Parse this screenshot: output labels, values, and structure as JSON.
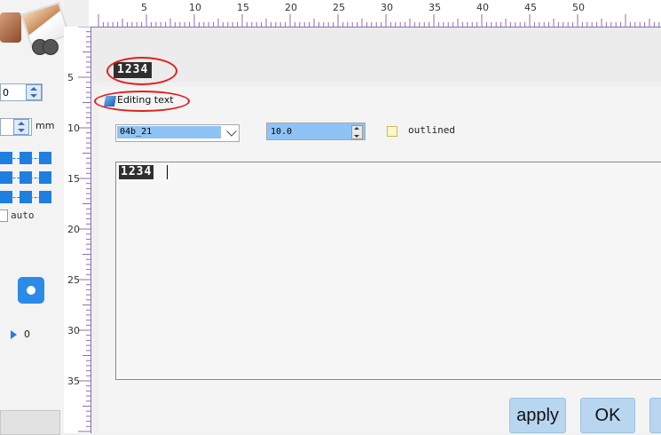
{
  "left_panel": {
    "spin_top_value": "0",
    "unit_label": "mm",
    "auto_label": "auto",
    "play_value": "0"
  },
  "ruler": {
    "h_labels": [
      "5",
      "10",
      "15",
      "20",
      "25",
      "30",
      "35",
      "40",
      "45",
      "50"
    ],
    "v_labels": [
      "5",
      "10",
      "15",
      "20",
      "25",
      "30",
      "35"
    ]
  },
  "preview": {
    "text": "1234"
  },
  "dialog": {
    "title": "Editing text",
    "font_value": "04b_21",
    "size_value": "10.0",
    "outlined_label": "outlined",
    "text_value": "1234",
    "apply_label": "apply",
    "ok_label": "OK"
  },
  "colors": {
    "accent": "#1e7fe0",
    "highlight": "#8fc3f5",
    "annotation": "#e02020"
  }
}
